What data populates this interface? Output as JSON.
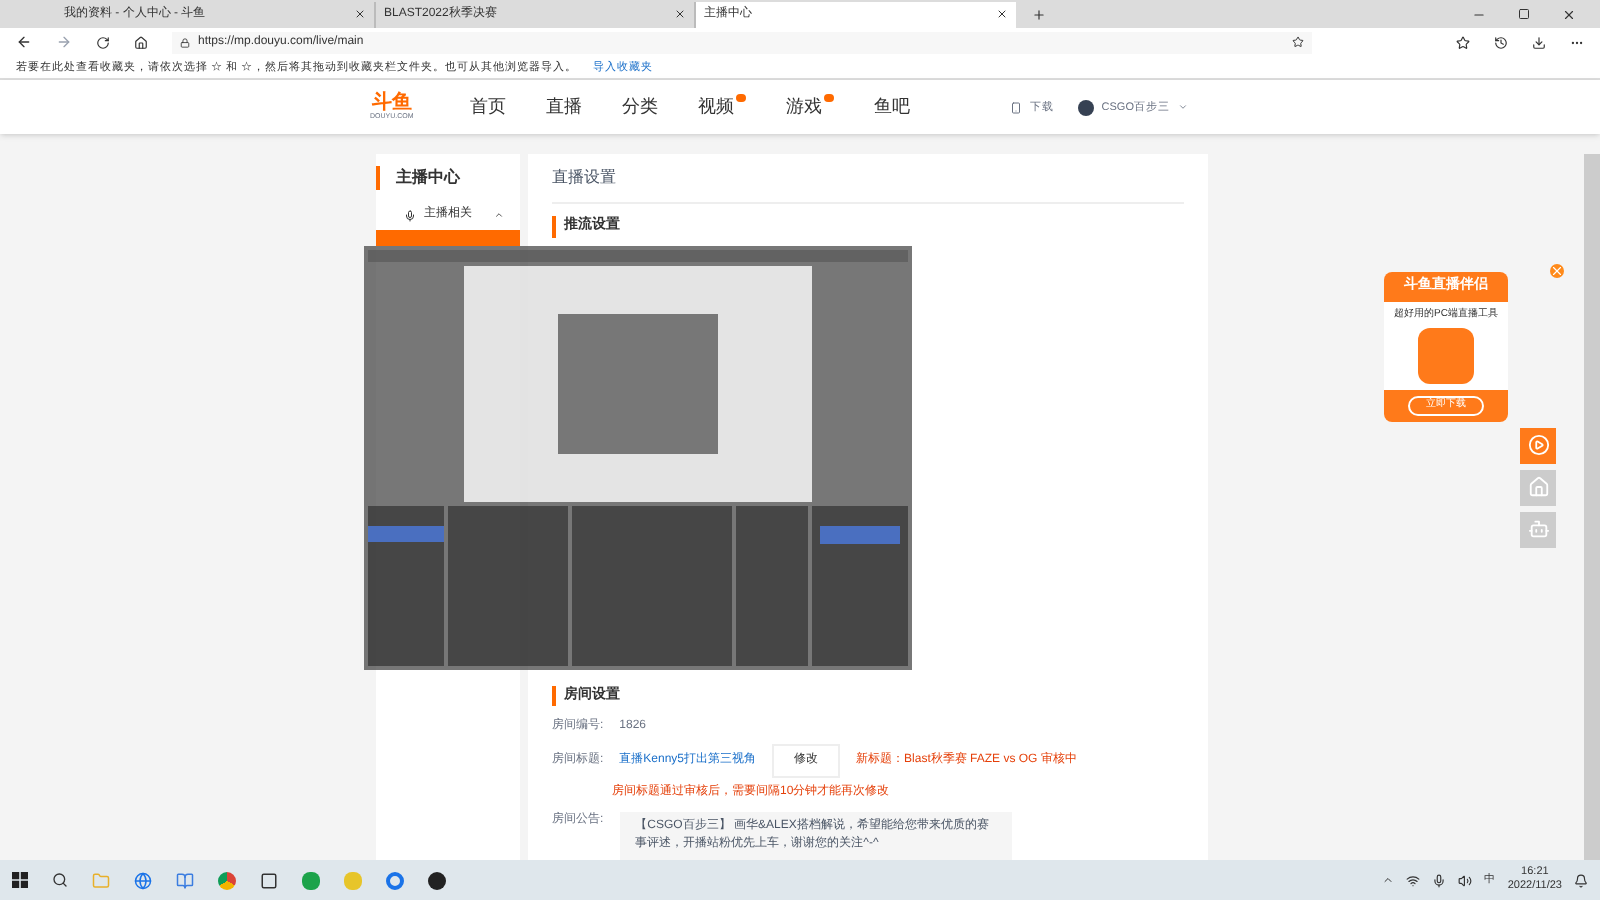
{
  "browser": {
    "tabs": [
      {
        "label": "我的资料 - 个人中心 - 斗鱼",
        "selected": false
      },
      {
        "label": "BLAST2022秋季决赛",
        "selected": false
      },
      {
        "label": "主播中心",
        "selected": true
      }
    ],
    "url": "https://mp.douyu.com/live/main",
    "favorites_hint": "若要在此处查看收藏夹，请依次选择 ☆ 和 ☆，然后将其拖动到收藏夹栏文件夹。也可从其他浏览器导入。",
    "favorites_link": "导入收藏夹"
  },
  "site": {
    "logo": "斗鱼",
    "logo_sub": "DOUYU.COM",
    "nav": [
      {
        "label": "首页",
        "badge": false
      },
      {
        "label": "直播",
        "badge": false
      },
      {
        "label": "分类",
        "badge": false
      },
      {
        "label": "视频",
        "badge": true
      },
      {
        "label": "游戏",
        "badge": true
      },
      {
        "label": "鱼吧",
        "badge": false
      }
    ],
    "download": "下载",
    "user": "CSGO百步三"
  },
  "sidebar": {
    "title": "主播中心",
    "group": "主播相关",
    "expanded": true
  },
  "main": {
    "title": "直播设置",
    "stream_section": "推流设置",
    "room_section": "房间设置",
    "room_number_label": "房间编号:",
    "room_number": "1826",
    "room_title_label": "房间标题:",
    "room_title": "直播Kenny5打出第三视角",
    "edit": "修改",
    "new_title": "新标题：Blast秋季赛 FAZE vs OG   审核中",
    "title_note": "房间标题通过审核后，需要间隔10分钟才能再次修改",
    "notice_label": "房间公告:",
    "notice": "【CSGO百步三】 画华&ALEX搭档解说，希望能给您带来优质的赛事评述，开播站粉优先上车，谢谢您的关注^-^"
  },
  "promo": {
    "title": "斗鱼直播伴侣",
    "subtitle": "超好用的PC端直播工具",
    "button": "立即下载"
  },
  "taskbar": {
    "ime": "中",
    "time": "16:21",
    "date": "2022/11/23"
  }
}
